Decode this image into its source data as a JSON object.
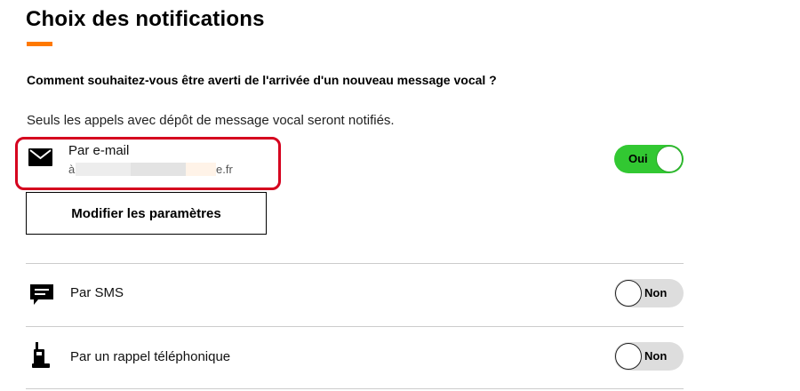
{
  "page_title": "Choix des notifications",
  "question": "Comment souhaitez-vous être averti de l'arrivée d'un nouveau message vocal ?",
  "info": "Seuls les appels avec dépôt de message vocal seront notifiés.",
  "email": {
    "icon": "envelope-icon",
    "label": "Par e-mail",
    "address_start": "à",
    "address_end": "e.fr",
    "toggle_state": "on",
    "toggle_label": "Oui"
  },
  "modify_button_label": "Modifier les paramètres",
  "sms": {
    "icon": "message-icon",
    "label": "Par SMS",
    "toggle_state": "off",
    "toggle_label": "Non"
  },
  "phone": {
    "icon": "phone-icon",
    "label": "Par un rappel téléphonique",
    "toggle_state": "off",
    "toggle_label": "Non"
  },
  "colors": {
    "accent": "#ff7900",
    "toggle_on": "#32c832",
    "toggle_off": "#dddddd",
    "highlight_border": "#d5001e"
  }
}
